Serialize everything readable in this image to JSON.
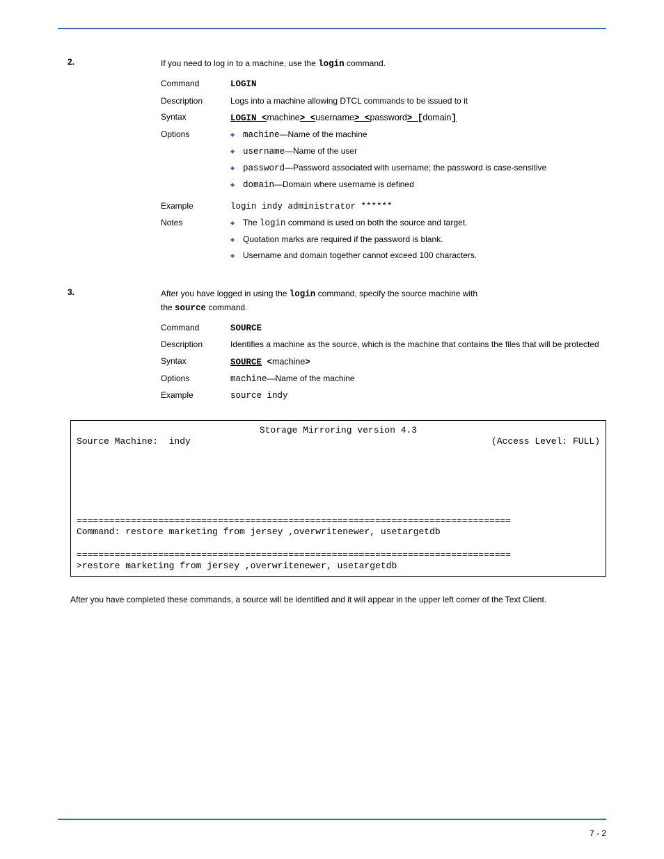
{
  "step2": {
    "intro_before": "If you need to log in to a machine, use the ",
    "intro_cmd": "login",
    "intro_after": " command.",
    "login": {
      "command_label": "Command",
      "command_value": "LOGIN",
      "desc_label": "Description",
      "desc_value": "Logs into a machine allowing DTCL commands to be issued to it",
      "syntax_label": "Syntax",
      "syntax_value_pre": "LOGIN <",
      "syntax_machine": "machine",
      "syntax_gt_lt1": "> <",
      "syntax_username": "username",
      "syntax_gt_lt2": "> <",
      "syntax_password": "password",
      "syntax_gt_open": "> [",
      "syntax_domain": "domain",
      "syntax_close": "]",
      "options_label": "Options",
      "options": [
        {
          "name": "machine",
          "text": "—Name of the machine"
        },
        {
          "name": "username",
          "text": "—Name of the user"
        },
        {
          "name": "password",
          "text": "—Password associated with username; the password is case-sensitive"
        },
        {
          "name": "domain",
          "text": "—Domain where username is defined"
        }
      ],
      "example_label": "Example",
      "example_value": "login indy administrator ******",
      "notes_label": "Notes",
      "notes": [
        {
          "pre": "The ",
          "cmd": "login",
          "post": " command is used on both the source and target."
        },
        {
          "text": "Quotation marks are required if the password is blank."
        },
        {
          "text": "Username and domain together cannot exceed 100 characters."
        }
      ]
    }
  },
  "step3": {
    "intro_l1_before": "After you have logged in using the ",
    "intro_l1_cmd": "login",
    "intro_l1_after": " command, specify the source machine with ",
    "intro_l2_before": "the ",
    "intro_l2_cmd": "source",
    "intro_l2_after": " command.",
    "source": {
      "command_label": "Command",
      "command_value": "SOURCE",
      "desc_label": "Description",
      "desc_value": "Identifies a machine as the source, which is the machine that contains the files that will be protected",
      "syntax_label": "Syntax",
      "syntax_pre": "SOURCE",
      "syntax_lt": " <",
      "syntax_machine": "machine",
      "syntax_gt": ">",
      "options_label": "Options",
      "options_name": "machine",
      "options_text": "—Name of the machine",
      "example_label": "Example",
      "example_value": "source indy"
    }
  },
  "terminal": {
    "title": "Storage Mirroring version 4.3",
    "source_label": "Source Machine:  ",
    "source_value": "indy",
    "access_label": "(Access Level: ",
    "access_value": "FULL",
    "access_close": ")",
    "sep": "================================================================================",
    "cmd_label": "Command: ",
    "cmd_value": "restore marketing from jersey ,overwritenewer, usetargetdb",
    "prompt": ">",
    "prompt_cmd": "restore marketing from jersey ,overwritenewer, usetargetdb"
  },
  "after": "After you have completed these commands, a source will be identified and it will appear in the upper left corner of the Text Client.",
  "page_number": "7 - 2"
}
